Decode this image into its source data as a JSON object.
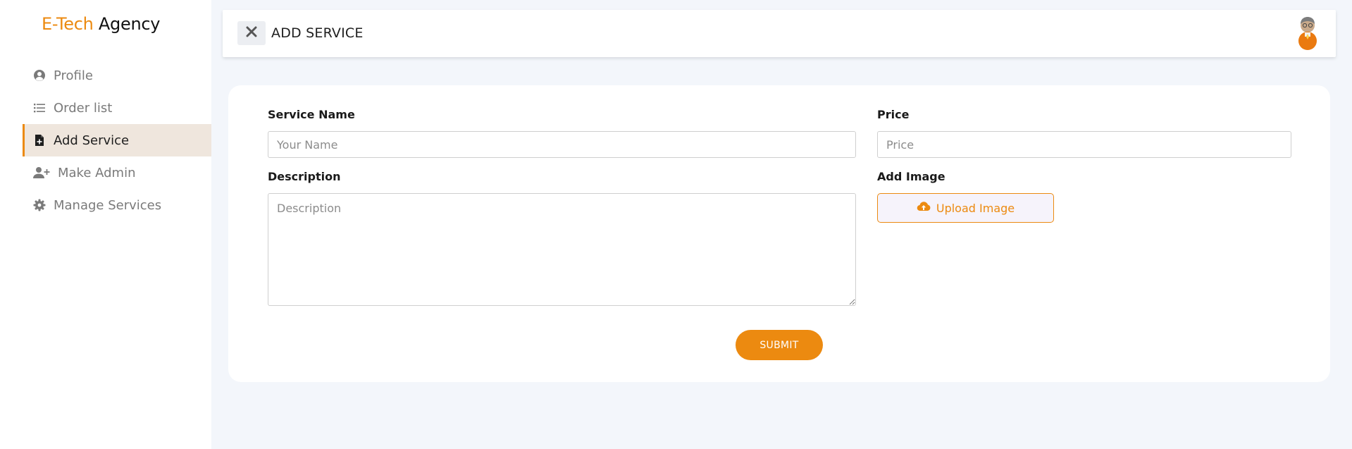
{
  "brand": {
    "accent": "E-Tech",
    "rest": "Agency"
  },
  "sidebar": {
    "items": [
      {
        "label": "Profile",
        "icon": "user-circle-icon"
      },
      {
        "label": "Order list",
        "icon": "list-icon"
      },
      {
        "label": "Add Service",
        "icon": "file-plus-icon",
        "active": true
      },
      {
        "label": "Make Admin",
        "icon": "user-plus-icon"
      },
      {
        "label": "Manage Services",
        "icon": "gear-icon"
      }
    ]
  },
  "header": {
    "title": "ADD SERVICE",
    "close_icon": "close-icon",
    "avatar_icon": "avatar-icon"
  },
  "form": {
    "service_name": {
      "label": "Service Name",
      "placeholder": "Your Name",
      "value": ""
    },
    "price": {
      "label": "Price",
      "placeholder": "Price",
      "value": ""
    },
    "description": {
      "label": "Description",
      "placeholder": "Description",
      "value": ""
    },
    "image": {
      "label": "Add Image",
      "button": "Upload Image",
      "icon": "cloud-upload-icon"
    },
    "submit": "SUBMIT"
  },
  "colors": {
    "accent": "#ec8a10",
    "page_bg": "#f3f6fb",
    "active_item_bg": "#efe6dd"
  }
}
